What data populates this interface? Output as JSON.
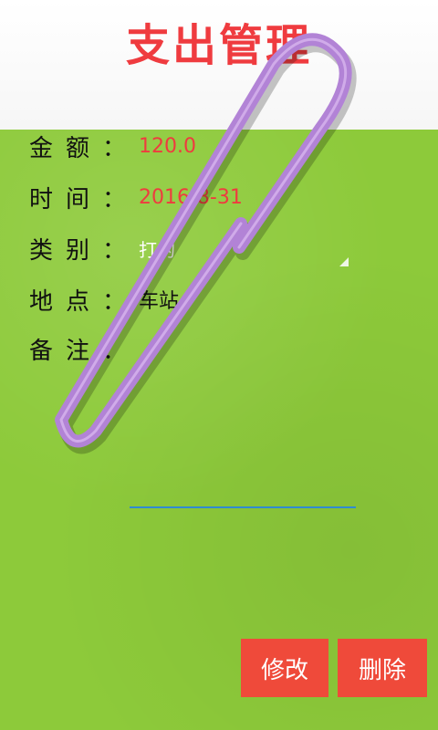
{
  "title": "支出管理",
  "fields": [
    {
      "label": "金额：",
      "value": "120.0"
    },
    {
      "label": "时间：",
      "value": "2016-8-31"
    },
    {
      "label": "类别：",
      "value": "打的"
    },
    {
      "label": "地点：",
      "value": "车站"
    },
    {
      "label": "备注：",
      "value": ""
    }
  ],
  "buttons": {
    "modify": "修改",
    "delete": "删除"
  },
  "colors": {
    "accent": "#ef3b3f",
    "background_green": "#8dca3a",
    "clip": "#b283d6",
    "input_line": "#2f8bd2"
  },
  "icons": {
    "decoration": "paperclip-icon",
    "dropdown": "dropdown-triangle-icon"
  }
}
